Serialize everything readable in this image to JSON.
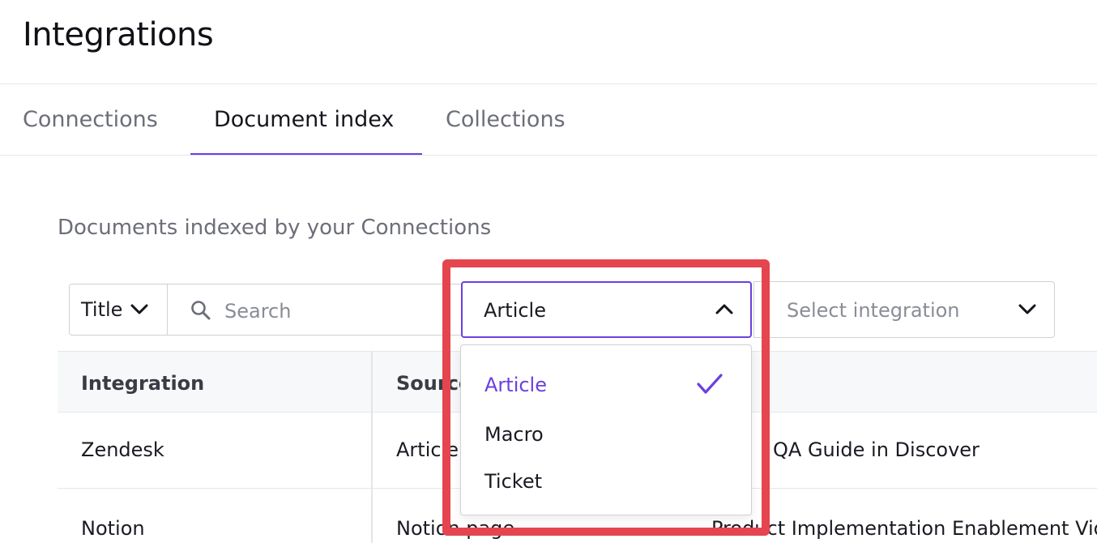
{
  "header": {
    "title": "Integrations"
  },
  "tabs": [
    {
      "label": "Connections",
      "active": false
    },
    {
      "label": "Document index",
      "active": true
    },
    {
      "label": "Collections",
      "active": false
    }
  ],
  "main": {
    "subtitle": "Documents indexed by your Connections",
    "filters": {
      "field_select": {
        "value": "Title"
      },
      "search": {
        "placeholder": "Search",
        "value": ""
      },
      "source_type_select": {
        "value": "Article",
        "open": true,
        "options": [
          {
            "label": "Article",
            "selected": true
          },
          {
            "label": "Macro",
            "selected": false
          },
          {
            "label": "Ticket",
            "selected": false
          }
        ]
      },
      "integration_select": {
        "placeholder": "Select integration"
      }
    },
    "table": {
      "columns": [
        "Integration",
        "Source"
      ],
      "rows": [
        {
          "integration": "Zendesk",
          "source_type": "Article",
          "title": "QA Guide in Discover"
        },
        {
          "integration": "Notion",
          "source_type": "Notion page",
          "title": "Product Implementation Enablement Vid"
        }
      ]
    }
  },
  "colors": {
    "accent": "#6b3fe0",
    "highlight": "#e5454e"
  }
}
